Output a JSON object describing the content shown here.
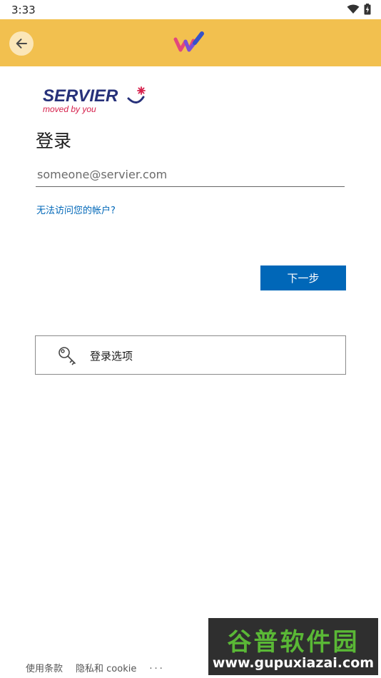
{
  "status_bar": {
    "time": "3:33",
    "icons": [
      "wifi-icon",
      "battery-charging-icon"
    ]
  },
  "app_bar": {
    "back_icon": "arrow-left-icon",
    "logo_icon": "app-logo-icon",
    "accent_color": "#f2c04f"
  },
  "brand": {
    "name": "SERVIER",
    "tagline": "moved by you"
  },
  "login": {
    "title": "登录",
    "email_placeholder": "someone@servier.com",
    "email_value": "",
    "cant_access_link": "无法访问您的帐户?",
    "next_button": "下一步",
    "signin_options": "登录选项",
    "signin_options_icon": "key-icon"
  },
  "footer": {
    "terms": "使用条款",
    "privacy": "隐私和 cookie",
    "more": "..."
  },
  "watermark": {
    "title": "谷普软件园",
    "url": "www.gupuxiazai.com"
  },
  "colors": {
    "primary_button": "#0067b8",
    "link": "#0067b8",
    "brand_navy": "#27317a",
    "brand_accent": "#d6204c"
  }
}
